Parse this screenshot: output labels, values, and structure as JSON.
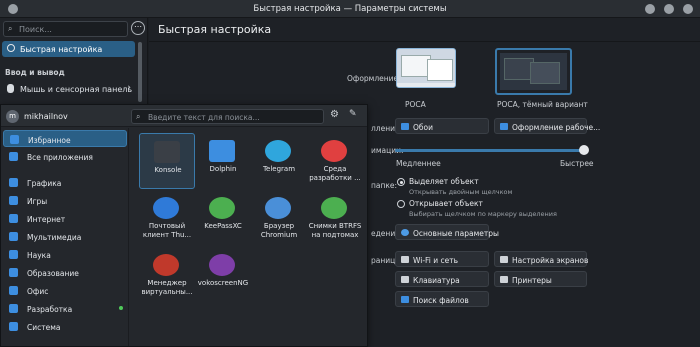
{
  "window": {
    "title": "Быстрая настройка — Параметры системы"
  },
  "sidebar": {
    "search_placeholder": "Поиск...",
    "menu_icon": "ellipsis-icon",
    "active_item": "Быстрая настройка",
    "section": "Ввод и вывод",
    "items": [
      {
        "label": "Мышь и сенсорная панель"
      }
    ]
  },
  "main": {
    "title": "Быстрая настройка",
    "appearance_label": "Оформление:",
    "themes": [
      {
        "label": "РОСА"
      },
      {
        "label": "РОСА, тёмный вариант"
      }
    ],
    "row_labels": {
      "wallpaper": "лления:",
      "animation": "имации:",
      "click": "папке:",
      "behavior": "едения:",
      "pages": "раницы:"
    },
    "wallpaper_button": "Обои",
    "appearance_button": "Оформление рабоче...",
    "slider": {
      "min_label": "Медленнее",
      "max_label": "Быстрее",
      "value": 1.0
    },
    "click": {
      "option1": "Выделяет объект",
      "option1_desc": "Открывать двойным щелчком",
      "option2": "Открывает объект",
      "option2_desc": "Выбирать щелчком по маркеру выделения",
      "selected": "option1"
    },
    "basic_button": "Основные параметры",
    "links": [
      "Wi-Fi и сеть",
      "Настройка экранов",
      "Клавиатура",
      "Принтеры",
      "Поиск файлов"
    ]
  },
  "launcher": {
    "user": "mikhailnov",
    "search_placeholder": "Введите текст для поиска...",
    "categories": [
      {
        "label": "Избранное",
        "color": "#3d8ee0"
      },
      {
        "label": "Все приложения",
        "color": "#3d8ee0"
      },
      {
        "label": "Графика",
        "color": "#3d8ee0"
      },
      {
        "label": "Игры",
        "color": "#3d8ee0"
      },
      {
        "label": "Интернет",
        "color": "#3d8ee0"
      },
      {
        "label": "Мультимедиа",
        "color": "#3d8ee0"
      },
      {
        "label": "Наука",
        "color": "#3d8ee0"
      },
      {
        "label": "Образование",
        "color": "#3d8ee0"
      },
      {
        "label": "Офис",
        "color": "#3d8ee0"
      },
      {
        "label": "Разработка",
        "color": "#3d8ee0"
      },
      {
        "label": "Система",
        "color": "#3d8ee0"
      }
    ],
    "apps": [
      {
        "label": "Konsole",
        "icon": "konsole-icon",
        "color": "#3a3f46"
      },
      {
        "label": "Dolphin",
        "icon": "folder-icon",
        "color": "#3d8ee0"
      },
      {
        "label": "Telegram",
        "icon": "telegram-icon",
        "color": "#2fa6dd"
      },
      {
        "label": "Среда разработки ...",
        "icon": "ide-icon",
        "color": "#e04040"
      },
      {
        "label": "Почтовый клиент Thu...",
        "icon": "thunderbird-icon",
        "color": "#2f7ad8"
      },
      {
        "label": "KeePassXC",
        "icon": "keepass-icon",
        "color": "#4caf50"
      },
      {
        "label": "Браузер Chromium",
        "icon": "chromium-icon",
        "color": "#4a8fd8"
      },
      {
        "label": "Снимки BTRFS на подтомах",
        "icon": "btrfs-icon",
        "color": "#4caf50"
      },
      {
        "label": "Менеджер виртуальны...",
        "icon": "virt-manager-icon",
        "color": "#c0392b"
      },
      {
        "label": "vokoscreenNG",
        "icon": "vokoscreen-icon",
        "color": "#7e3ea8"
      }
    ]
  }
}
